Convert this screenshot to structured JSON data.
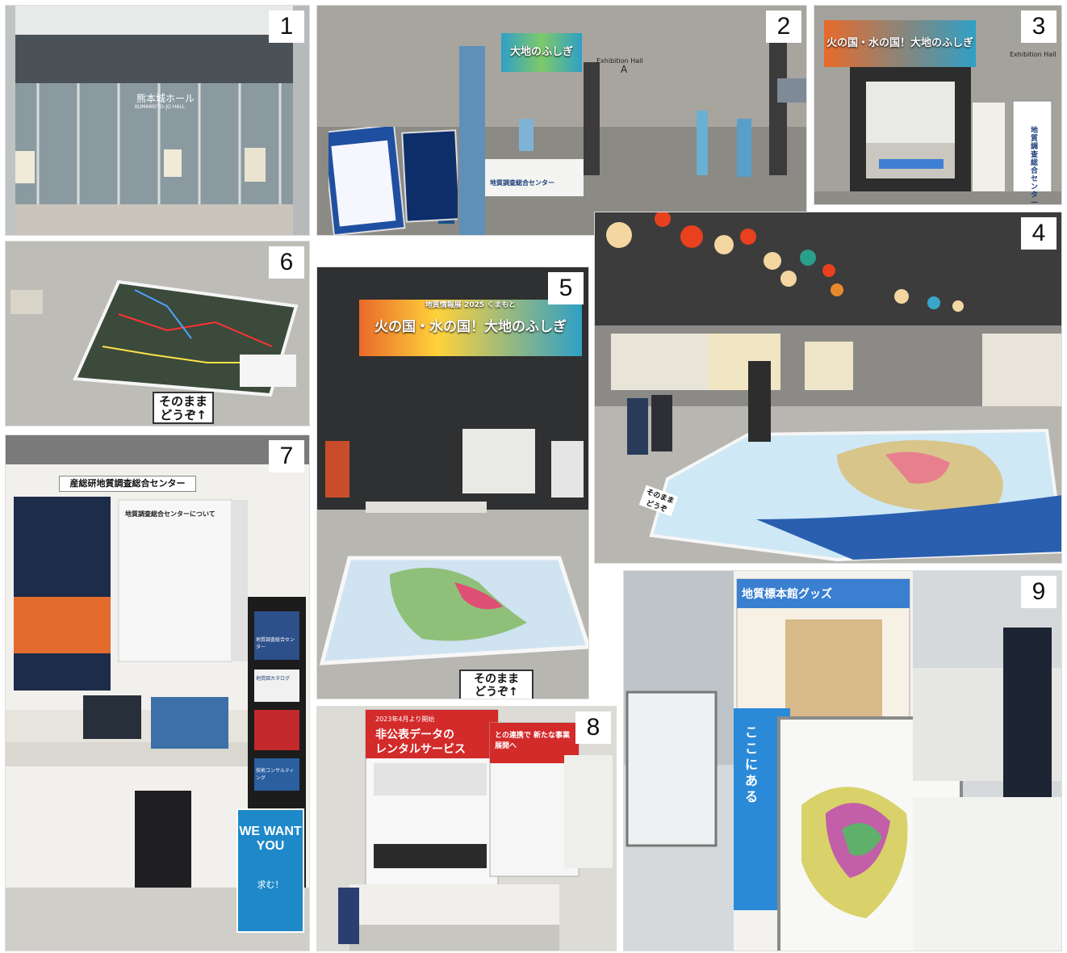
{
  "photos": [
    {
      "number": "1"
    },
    {
      "number": "2"
    },
    {
      "number": "3"
    },
    {
      "number": "4"
    },
    {
      "number": "5"
    },
    {
      "number": "6"
    },
    {
      "number": "7"
    },
    {
      "number": "8"
    },
    {
      "number": "9"
    }
  ],
  "photo1": {
    "building_sign": "熊本城ホール",
    "building_sign_en": "KUMAMOTO-JO HALL"
  },
  "photo2": {
    "hall_sign": "Exhibition Hall",
    "hall_letter": "A",
    "banner": "大地のふしぎ",
    "booth_sign": "地質調査総合センター"
  },
  "photo3": {
    "banner": "火の国・水の国！大地のふしぎ",
    "hall_sign": "Exhibition Hall",
    "standee": "地質調査総合センター"
  },
  "photo4": {
    "floor_sign": "そのまま どうぞ"
  },
  "photo5": {
    "banner_small": "地質情報展 2025 くまもと",
    "banner": "火の国・水の国！大地のふしぎ",
    "floor_sign_line1": "そのまま",
    "floor_sign_line2": "どうぞ↑"
  },
  "photo6": {
    "floor_sign_line1": "そのまま",
    "floor_sign_line2": "どうぞ↑"
  },
  "photo7": {
    "panel_header": "産総研地質調査総合センター",
    "panel_subtitle": "地質調査総合センターについて",
    "rack_items": [
      "地質調査総合センター",
      "地質図カタログ",
      "技術コンサルティング"
    ],
    "poster": "WE WANT YOU",
    "poster_sub": "求む！"
  },
  "photo8": {
    "poster_head": "2023年4月より開始",
    "poster_title_line1": "非公表データの",
    "poster_title_line2": "レンタルサービス",
    "poster2_title": "との連携で 新たな事業展開へ"
  },
  "photo9": {
    "poster_title": "地質標本館グッズ",
    "vertical_text": "ここにある"
  },
  "colors": {
    "wall_gray": "#8f8f8f",
    "floor_gray": "#b9b9b4",
    "sea_blue": "#3a78c8",
    "banner_orange": "#e86a2a",
    "banner_teal": "#2fa0c6",
    "red_poster": "#d32a2a"
  }
}
